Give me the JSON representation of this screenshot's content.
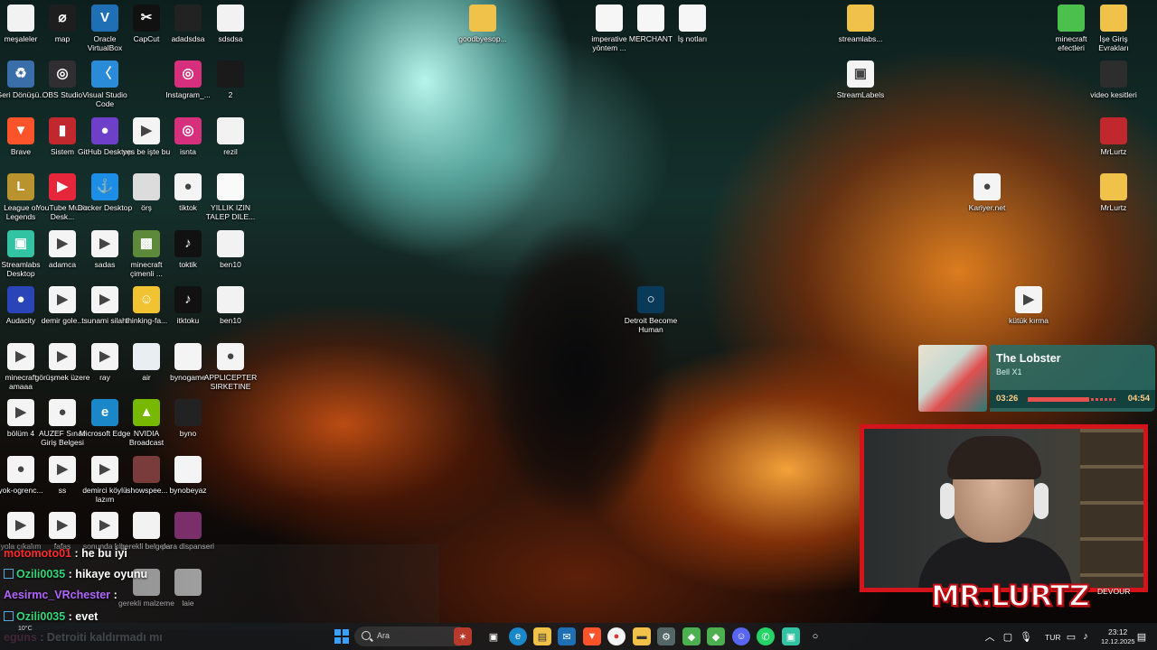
{
  "desktop_icons": [
    {
      "label": "meşaleler",
      "glyph": "",
      "color": "#f2f2f2"
    },
    {
      "label": "map",
      "glyph": "⌀",
      "color": "#1e1e1e"
    },
    {
      "label": "Oracle VirtualBox",
      "glyph": "V",
      "color": "#1f6fb5"
    },
    {
      "label": "CapCut",
      "glyph": "✂",
      "color": "#111111"
    },
    {
      "label": "adadsdsa",
      "glyph": "",
      "color": "#222222"
    },
    {
      "label": "sdsdsa",
      "glyph": "",
      "color": "#f2f2f2"
    },
    {
      "label": "Geri Dönüşü...",
      "glyph": "♻",
      "color": "#3a6ea8"
    },
    {
      "label": "OBS Studio",
      "glyph": "◎",
      "color": "#302e31"
    },
    {
      "label": "Visual Studio Code",
      "glyph": "〈",
      "color": "#2a8bd8"
    },
    {
      "label": "Instagram_...",
      "glyph": "◎",
      "color": "#d62f7b"
    },
    {
      "label": "2",
      "glyph": "",
      "color": "#1a1a1a"
    },
    {
      "label": "Brave",
      "glyph": "▼",
      "color": "#fb542b"
    },
    {
      "label": "Sistem",
      "glyph": "▮",
      "color": "#c0282d"
    },
    {
      "label": "GitHub Desktop",
      "glyph": "●",
      "color": "#6e40c9"
    },
    {
      "label": "yes be işte bu",
      "glyph": "▶",
      "color": "#f4f4f4"
    },
    {
      "label": "isnta",
      "glyph": "◎",
      "color": "#d62f7b"
    },
    {
      "label": "rezil",
      "glyph": "",
      "color": "#f2f2f2"
    },
    {
      "label": "League of Legends",
      "glyph": "L",
      "color": "#b8932e"
    },
    {
      "label": "YouTube Music Desk...",
      "glyph": "▶",
      "color": "#e5263b"
    },
    {
      "label": "Docker Desktop",
      "glyph": "⚓",
      "color": "#1d8ee6"
    },
    {
      "label": "örş",
      "glyph": "",
      "color": "#dcdcdc"
    },
    {
      "label": "tiktok",
      "glyph": "●",
      "color": "#f4f4f4"
    },
    {
      "label": "YILLIK IZIN TALEP DILE...",
      "glyph": "",
      "color": "#fafafa"
    },
    {
      "label": "Streamlabs Desktop",
      "glyph": "▣",
      "color": "#31c3a2"
    },
    {
      "label": "adamca",
      "glyph": "▶",
      "color": "#f4f4f4"
    },
    {
      "label": "sadas",
      "glyph": "▶",
      "color": "#f4f4f4"
    },
    {
      "label": "minecraft çimenli ...",
      "glyph": "▩",
      "color": "#5c8a3a"
    },
    {
      "label": "toktik",
      "glyph": "♪",
      "color": "#111111"
    },
    {
      "label": "ben10",
      "glyph": "",
      "color": "#f2f2f2"
    },
    {
      "label": "Audacity",
      "glyph": "●",
      "color": "#2945b8"
    },
    {
      "label": "demir gole...",
      "glyph": "▶",
      "color": "#f4f4f4"
    },
    {
      "label": "tsunami silahi",
      "glyph": "▶",
      "color": "#f4f4f4"
    },
    {
      "label": "thinking-fa...",
      "glyph": "☺",
      "color": "#f1c232"
    },
    {
      "label": "itktoku",
      "glyph": "♪",
      "color": "#111111"
    },
    {
      "label": "ben10",
      "glyph": "",
      "color": "#f2f2f2"
    },
    {
      "label": "minecraft amaaa",
      "glyph": "▶",
      "color": "#f4f4f4"
    },
    {
      "label": "görüşmek üzere",
      "glyph": "▶",
      "color": "#f4f4f4"
    },
    {
      "label": "ray",
      "glyph": "▶",
      "color": "#f4f4f4"
    },
    {
      "label": "air",
      "glyph": "",
      "color": "#e8eef2"
    },
    {
      "label": "bynogame",
      "glyph": "",
      "color": "#f4f4f4"
    },
    {
      "label": "APPLICEPTER SIRKETINE",
      "glyph": "●",
      "color": "#f4f4f4"
    },
    {
      "label": "bölüm 4",
      "glyph": "▶",
      "color": "#f4f4f4"
    },
    {
      "label": "AUZEF Sınav Giriş Belgesi",
      "glyph": "●",
      "color": "#f4f4f4"
    },
    {
      "label": "Microsoft Edge",
      "glyph": "e",
      "color": "#1a87c9"
    },
    {
      "label": "NVIDIA Broadcast",
      "glyph": "▲",
      "color": "#76b900"
    },
    {
      "label": "byno",
      "glyph": "",
      "color": "#222222"
    },
    {
      "label": "yok-ogrenc...",
      "glyph": "●",
      "color": "#f4f4f4"
    },
    {
      "label": "ss",
      "glyph": "▶",
      "color": "#f4f4f4"
    },
    {
      "label": "demirci köylü lazım",
      "glyph": "▶",
      "color": "#f4f4f4"
    },
    {
      "label": "ishowspee...",
      "glyph": "",
      "color": "#7a3b3b"
    },
    {
      "label": "bynobeyaz",
      "glyph": "",
      "color": "#f4f4f4"
    },
    {
      "label": "yola çıkalım",
      "glyph": "▶",
      "color": "#f4f4f4"
    },
    {
      "label": "fafas",
      "glyph": "▶",
      "color": "#f4f4f4"
    },
    {
      "label": "sonunda köy",
      "glyph": "▶",
      "color": "#f4f4f4"
    },
    {
      "label": "gerekli belgeler",
      "glyph": "",
      "color": "#f2f2f2"
    },
    {
      "label": "para dispanseri",
      "glyph": "",
      "color": "#7a2f6a"
    },
    {
      "label": "gerekli malzeme",
      "glyph": "",
      "color": "#f2f2f2"
    },
    {
      "label": "laie",
      "glyph": "",
      "color": "#f2f2f2"
    },
    {
      "label": "goodbyesop...",
      "glyph": "",
      "color": "#f0c24a"
    },
    {
      "label": "imperative yöntem ...",
      "glyph": "",
      "color": "#f6f6f6"
    },
    {
      "label": "MERCHANT",
      "glyph": "",
      "color": "#f6f6f6"
    },
    {
      "label": "İş notları",
      "glyph": "",
      "color": "#f6f6f6"
    },
    {
      "label": "streamlabs...",
      "glyph": "",
      "color": "#f0c24a"
    },
    {
      "label": "StreamLabels",
      "glyph": "▣",
      "color": "#f4f4f4"
    },
    {
      "label": "minecraft efectleri",
      "glyph": "",
      "color": "#4cc04c"
    },
    {
      "label": "İşe Giriş Evrakları",
      "glyph": "",
      "color": "#f0c24a"
    },
    {
      "label": "video kesitleri",
      "glyph": "",
      "color": "#2d2d2d"
    },
    {
      "label": "MrLurtz",
      "glyph": "",
      "color": "#c0282d"
    },
    {
      "label": "MrLurtz",
      "glyph": "",
      "color": "#f0c24a"
    },
    {
      "label": "Kariyer.net",
      "glyph": "●",
      "color": "#f4f4f4"
    },
    {
      "label": "kütük kırma",
      "glyph": "▶",
      "color": "#f4f4f4"
    },
    {
      "label": "Detroit Become Human",
      "glyph": "○",
      "color": "#0a3a5a"
    }
  ],
  "music": {
    "title": "The Lobster",
    "artist": "Bell X1",
    "current": "03:26",
    "total": "04:54",
    "progress": 0.7
  },
  "webcam": {
    "brand_text": "MR.LURTZ",
    "game_label": "DEVOUR",
    "frame_color": "#d4141a"
  },
  "chat": [
    {
      "user": "motomoto01",
      "user_color": "#ff2a2a",
      "message": ": he bu iyi",
      "icon": false
    },
    {
      "user": "Ozili0035",
      "user_color": "#31d67a",
      "message": ": hikaye oyunu",
      "icon": true
    },
    {
      "user": "Aesirmc_VRchester",
      "user_color": "#b266ff",
      "message": ":",
      "icon": false
    },
    {
      "user": "Ozili0035",
      "user_color": "#31d67a",
      "message": ": evet",
      "icon": true
    },
    {
      "user": "eguns",
      "user_color": "#ff4da6",
      "message": ": Detroiti kaldırmadı mı",
      "icon": false
    }
  ],
  "taskbar": {
    "search_placeholder": "Ara",
    "language": "TUR",
    "time": "23:12",
    "date": "12.12.2025",
    "weather": "10°C"
  }
}
